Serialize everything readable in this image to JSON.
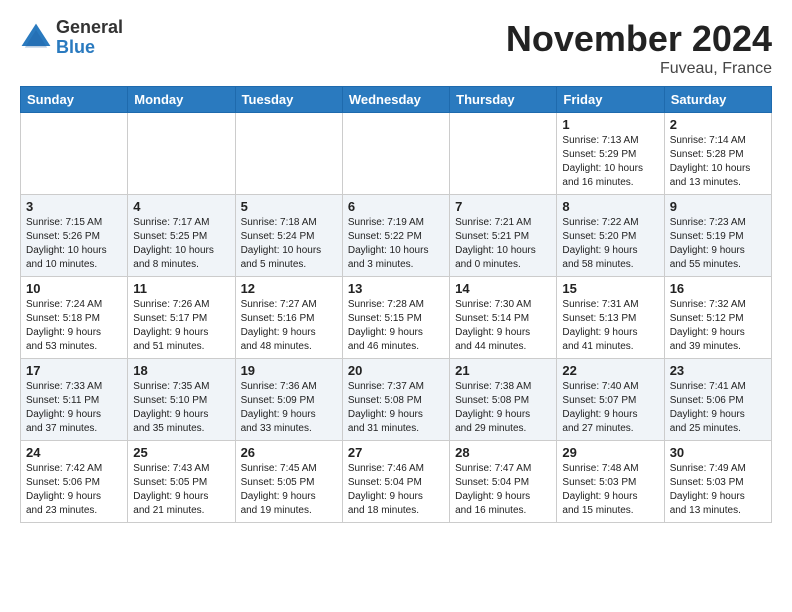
{
  "header": {
    "logo_general": "General",
    "logo_blue": "Blue",
    "month": "November 2024",
    "location": "Fuveau, France"
  },
  "weekdays": [
    "Sunday",
    "Monday",
    "Tuesday",
    "Wednesday",
    "Thursday",
    "Friday",
    "Saturday"
  ],
  "weeks": [
    [
      {
        "day": "",
        "info": ""
      },
      {
        "day": "",
        "info": ""
      },
      {
        "day": "",
        "info": ""
      },
      {
        "day": "",
        "info": ""
      },
      {
        "day": "",
        "info": ""
      },
      {
        "day": "1",
        "info": "Sunrise: 7:13 AM\nSunset: 5:29 PM\nDaylight: 10 hours\nand 16 minutes."
      },
      {
        "day": "2",
        "info": "Sunrise: 7:14 AM\nSunset: 5:28 PM\nDaylight: 10 hours\nand 13 minutes."
      }
    ],
    [
      {
        "day": "3",
        "info": "Sunrise: 7:15 AM\nSunset: 5:26 PM\nDaylight: 10 hours\nand 10 minutes."
      },
      {
        "day": "4",
        "info": "Sunrise: 7:17 AM\nSunset: 5:25 PM\nDaylight: 10 hours\nand 8 minutes."
      },
      {
        "day": "5",
        "info": "Sunrise: 7:18 AM\nSunset: 5:24 PM\nDaylight: 10 hours\nand 5 minutes."
      },
      {
        "day": "6",
        "info": "Sunrise: 7:19 AM\nSunset: 5:22 PM\nDaylight: 10 hours\nand 3 minutes."
      },
      {
        "day": "7",
        "info": "Sunrise: 7:21 AM\nSunset: 5:21 PM\nDaylight: 10 hours\nand 0 minutes."
      },
      {
        "day": "8",
        "info": "Sunrise: 7:22 AM\nSunset: 5:20 PM\nDaylight: 9 hours\nand 58 minutes."
      },
      {
        "day": "9",
        "info": "Sunrise: 7:23 AM\nSunset: 5:19 PM\nDaylight: 9 hours\nand 55 minutes."
      }
    ],
    [
      {
        "day": "10",
        "info": "Sunrise: 7:24 AM\nSunset: 5:18 PM\nDaylight: 9 hours\nand 53 minutes."
      },
      {
        "day": "11",
        "info": "Sunrise: 7:26 AM\nSunset: 5:17 PM\nDaylight: 9 hours\nand 51 minutes."
      },
      {
        "day": "12",
        "info": "Sunrise: 7:27 AM\nSunset: 5:16 PM\nDaylight: 9 hours\nand 48 minutes."
      },
      {
        "day": "13",
        "info": "Sunrise: 7:28 AM\nSunset: 5:15 PM\nDaylight: 9 hours\nand 46 minutes."
      },
      {
        "day": "14",
        "info": "Sunrise: 7:30 AM\nSunset: 5:14 PM\nDaylight: 9 hours\nand 44 minutes."
      },
      {
        "day": "15",
        "info": "Sunrise: 7:31 AM\nSunset: 5:13 PM\nDaylight: 9 hours\nand 41 minutes."
      },
      {
        "day": "16",
        "info": "Sunrise: 7:32 AM\nSunset: 5:12 PM\nDaylight: 9 hours\nand 39 minutes."
      }
    ],
    [
      {
        "day": "17",
        "info": "Sunrise: 7:33 AM\nSunset: 5:11 PM\nDaylight: 9 hours\nand 37 minutes."
      },
      {
        "day": "18",
        "info": "Sunrise: 7:35 AM\nSunset: 5:10 PM\nDaylight: 9 hours\nand 35 minutes."
      },
      {
        "day": "19",
        "info": "Sunrise: 7:36 AM\nSunset: 5:09 PM\nDaylight: 9 hours\nand 33 minutes."
      },
      {
        "day": "20",
        "info": "Sunrise: 7:37 AM\nSunset: 5:08 PM\nDaylight: 9 hours\nand 31 minutes."
      },
      {
        "day": "21",
        "info": "Sunrise: 7:38 AM\nSunset: 5:08 PM\nDaylight: 9 hours\nand 29 minutes."
      },
      {
        "day": "22",
        "info": "Sunrise: 7:40 AM\nSunset: 5:07 PM\nDaylight: 9 hours\nand 27 minutes."
      },
      {
        "day": "23",
        "info": "Sunrise: 7:41 AM\nSunset: 5:06 PM\nDaylight: 9 hours\nand 25 minutes."
      }
    ],
    [
      {
        "day": "24",
        "info": "Sunrise: 7:42 AM\nSunset: 5:06 PM\nDaylight: 9 hours\nand 23 minutes."
      },
      {
        "day": "25",
        "info": "Sunrise: 7:43 AM\nSunset: 5:05 PM\nDaylight: 9 hours\nand 21 minutes."
      },
      {
        "day": "26",
        "info": "Sunrise: 7:45 AM\nSunset: 5:05 PM\nDaylight: 9 hours\nand 19 minutes."
      },
      {
        "day": "27",
        "info": "Sunrise: 7:46 AM\nSunset: 5:04 PM\nDaylight: 9 hours\nand 18 minutes."
      },
      {
        "day": "28",
        "info": "Sunrise: 7:47 AM\nSunset: 5:04 PM\nDaylight: 9 hours\nand 16 minutes."
      },
      {
        "day": "29",
        "info": "Sunrise: 7:48 AM\nSunset: 5:03 PM\nDaylight: 9 hours\nand 15 minutes."
      },
      {
        "day": "30",
        "info": "Sunrise: 7:49 AM\nSunset: 5:03 PM\nDaylight: 9 hours\nand 13 minutes."
      }
    ]
  ]
}
